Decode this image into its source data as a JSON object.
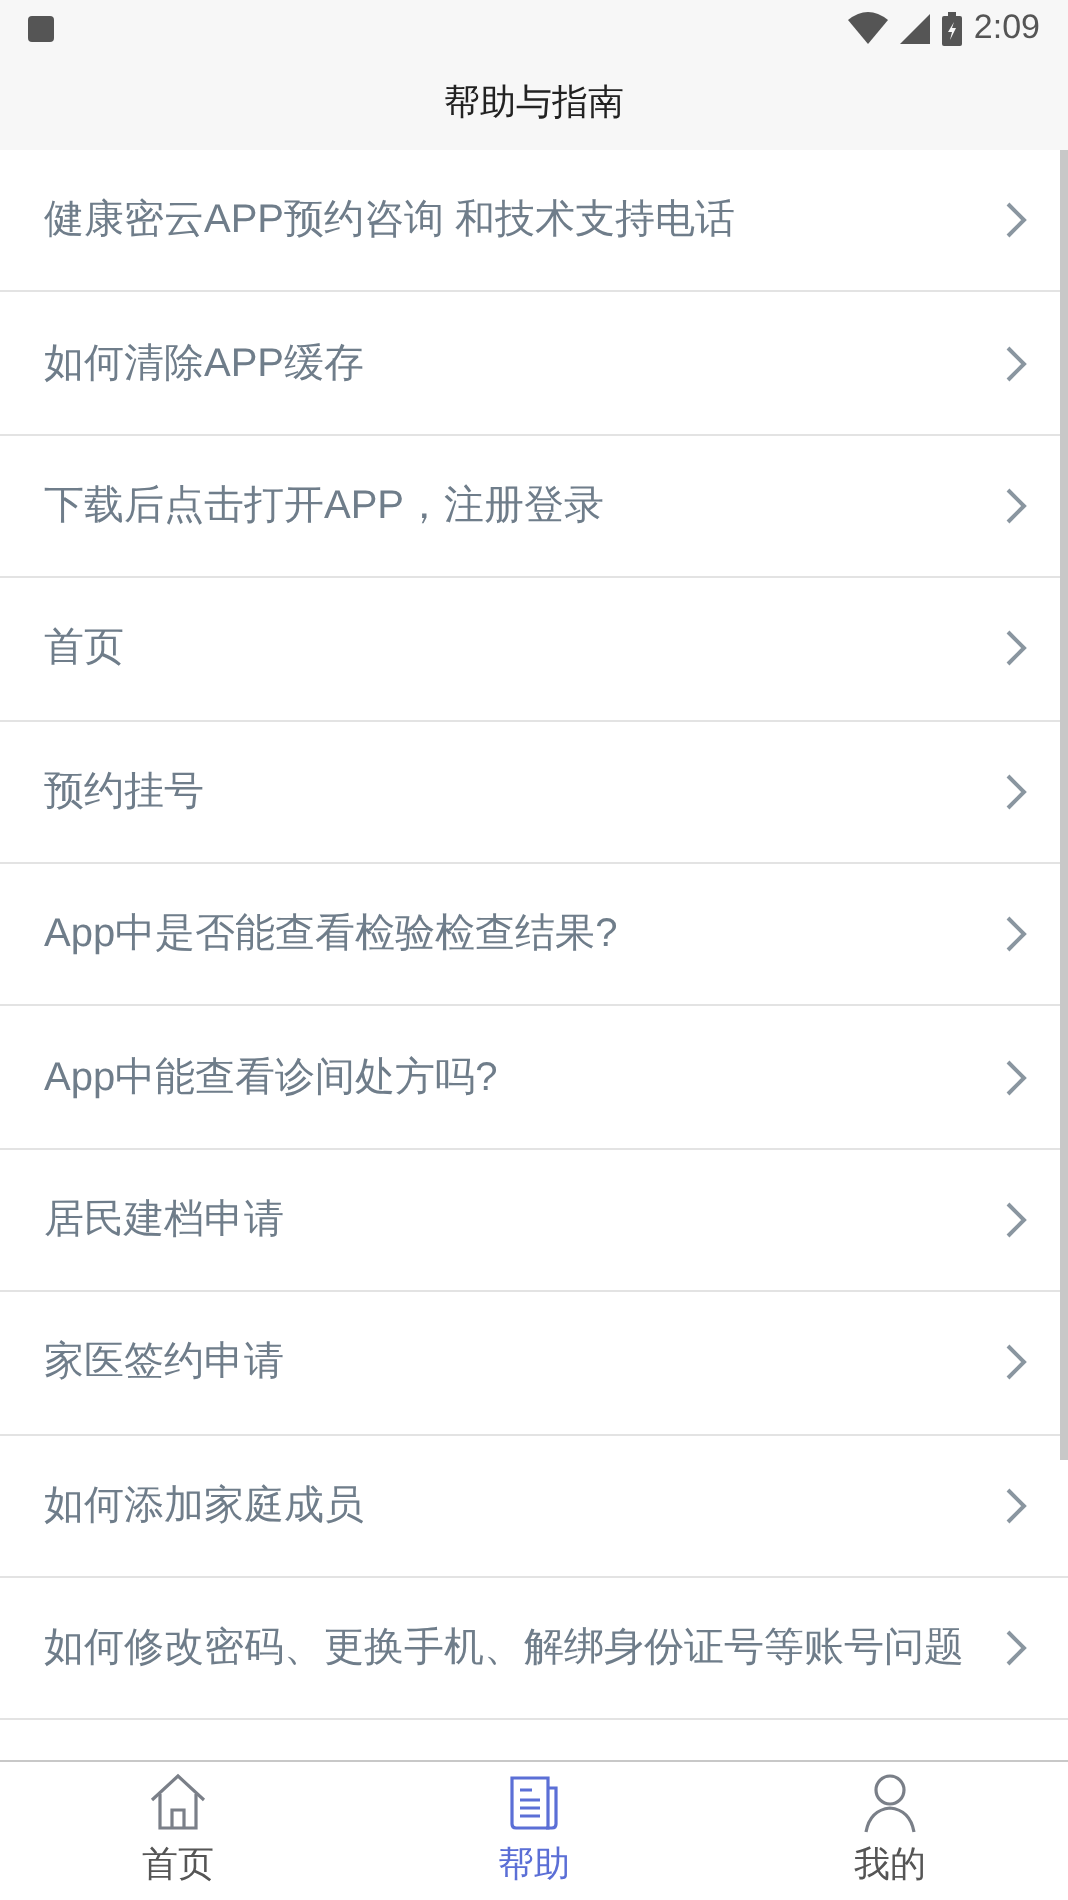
{
  "status_bar": {
    "time": "2:09"
  },
  "header": {
    "title": "帮助与指南"
  },
  "items": [
    {
      "label": "健康密云APP预约咨询 和技术支持电话"
    },
    {
      "label": "如何清除APP缓存"
    },
    {
      "label": "下载后点击打开APP，注册登录"
    },
    {
      "label": "首页"
    },
    {
      "label": "预约挂号"
    },
    {
      "label": "App中是否能查看检验检查结果?"
    },
    {
      "label": "App中能查看诊间处方吗?"
    },
    {
      "label": "居民建档申请"
    },
    {
      "label": "家医签约申请"
    },
    {
      "label": "如何添加家庭成员"
    },
    {
      "label": "如何修改密码、更换手机、解绑身份证号等账号问题"
    }
  ],
  "tab_bar": [
    {
      "kind": "home",
      "label": "首页",
      "selected": false
    },
    {
      "kind": "help",
      "label": "帮助",
      "selected": true
    },
    {
      "kind": "me",
      "label": "我的",
      "selected": false
    }
  ]
}
